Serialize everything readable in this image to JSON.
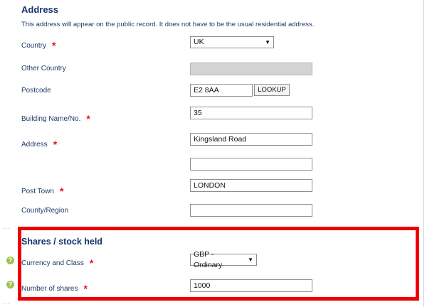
{
  "address_section": {
    "title": "Address",
    "description": "This address will appear on the public record. It does not have to be the usual residential address.",
    "fields": {
      "country": {
        "label": "Country",
        "value": "UK",
        "required_mark": "*"
      },
      "other_country": {
        "label": "Other Country",
        "value": ""
      },
      "postcode": {
        "label": "Postcode",
        "value": "E2 8AA",
        "lookup_label": "LOOKUP"
      },
      "building": {
        "label": "Building Name/No.",
        "value": "35",
        "required_mark": "*"
      },
      "address": {
        "label": "Address",
        "line1": "Kingsland Road",
        "line2": "",
        "required_mark": "*"
      },
      "post_town": {
        "label": "Post Town",
        "value": "LONDON",
        "required_mark": "*"
      },
      "county": {
        "label": "County/Region",
        "value": ""
      }
    }
  },
  "shares_section": {
    "title": "Shares / stock held",
    "currency_class": {
      "label": "Currency and Class",
      "value": "GBP - Ordinary",
      "required_mark": "*",
      "help": "?"
    },
    "number_of_shares": {
      "label": "Number of shares",
      "value": "1000",
      "required_mark": "*",
      "help": "?"
    }
  },
  "separators": {
    "dots": "..."
  },
  "colors": {
    "text": "#1f3b66",
    "required": "#e01616",
    "highlight_border": "#ee0000",
    "help_icon": "#9ec24a",
    "disabled_field": "#d4d4d4"
  },
  "icons": {
    "dropdown": "dropdown-arrow-icon",
    "help": "help-icon"
  }
}
